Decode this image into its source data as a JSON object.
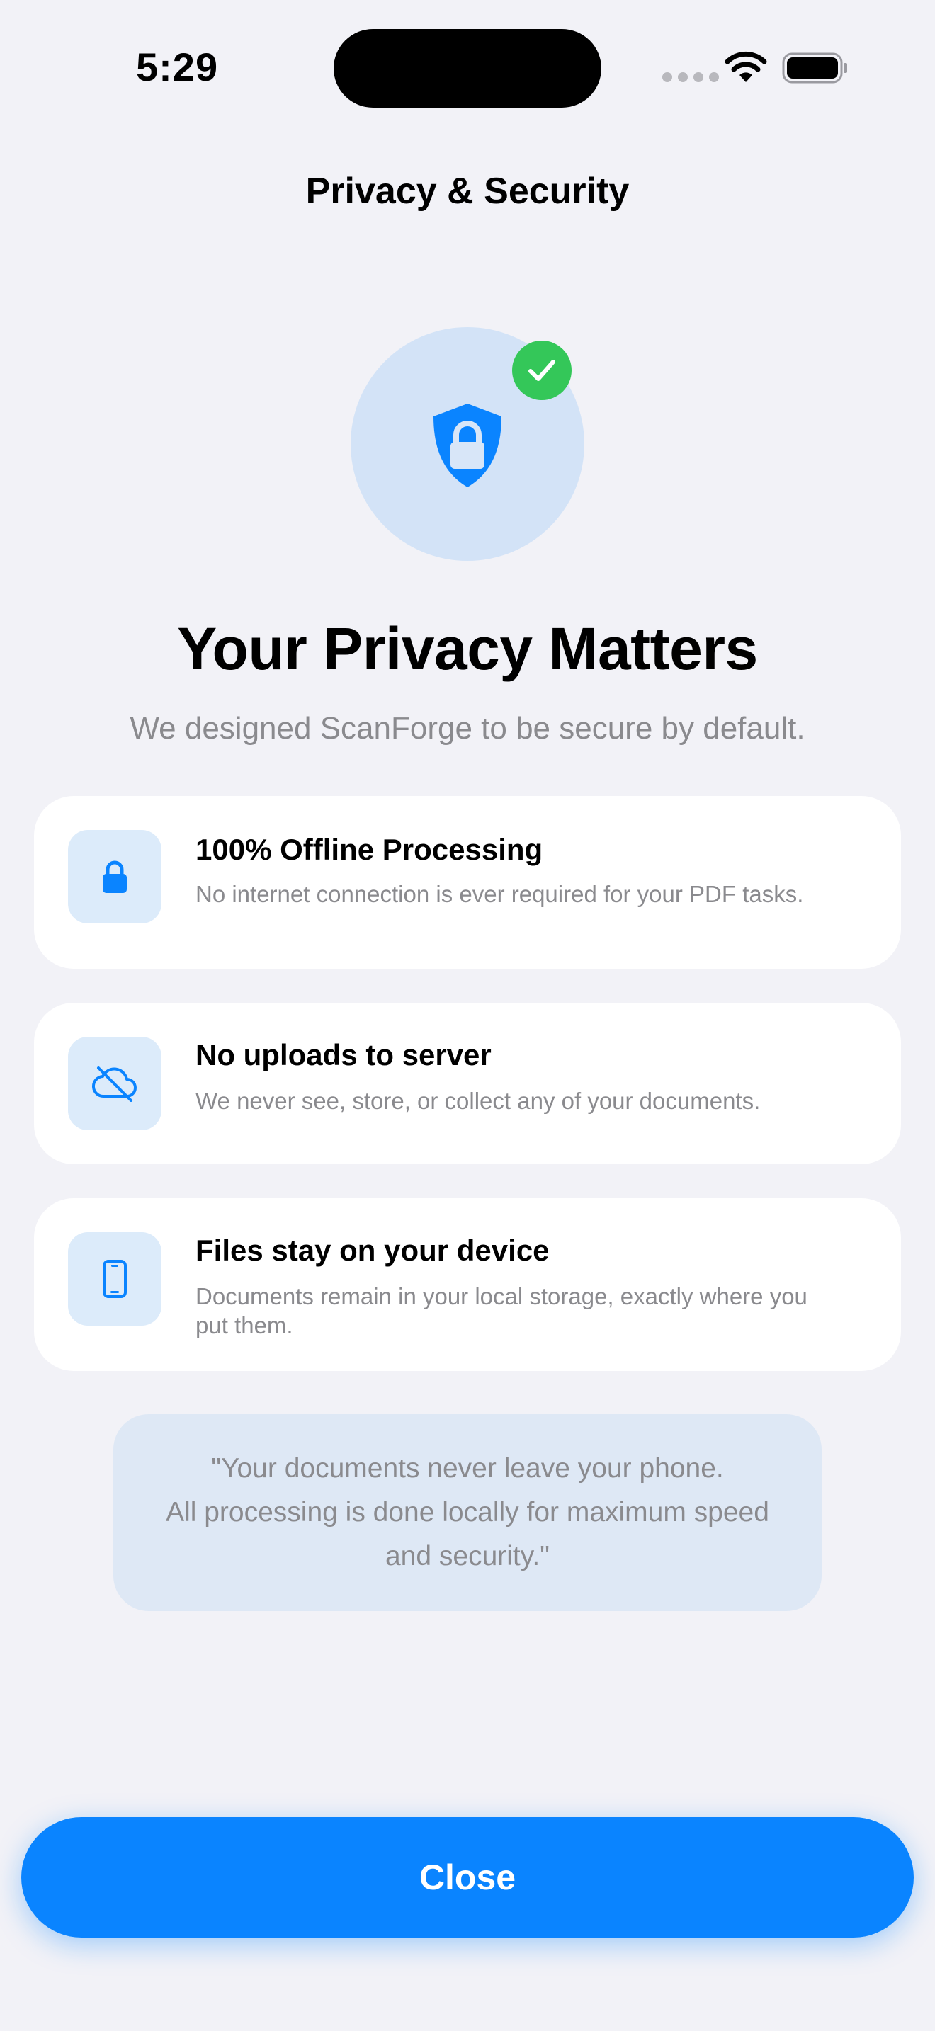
{
  "status_bar": {
    "time": "5:29"
  },
  "nav": {
    "title": "Privacy & Security"
  },
  "hero": {
    "headline": "Your Privacy Matters",
    "subheadline": "We designed ScanForge to be secure by default."
  },
  "features": [
    {
      "icon": "lock-icon",
      "title": "100% Offline Processing",
      "description": "No internet connection is ever required for your PDF tasks."
    },
    {
      "icon": "cloud-off-icon",
      "title": "No uploads to server",
      "description": "We never see, store, or collect any of your documents."
    },
    {
      "icon": "phone-icon",
      "title": "Files stay on your device",
      "description": "Documents remain in your local storage, exactly where you put them."
    }
  ],
  "quote": {
    "text": "\"Your documents never leave your phone.\nAll processing is done locally for maximum speed and security.\""
  },
  "actions": {
    "close_label": "Close"
  },
  "colors": {
    "accent": "#0A84FF",
    "success": "#34C759",
    "background": "#F2F2F7",
    "secondary_text": "#8A8A8E"
  }
}
